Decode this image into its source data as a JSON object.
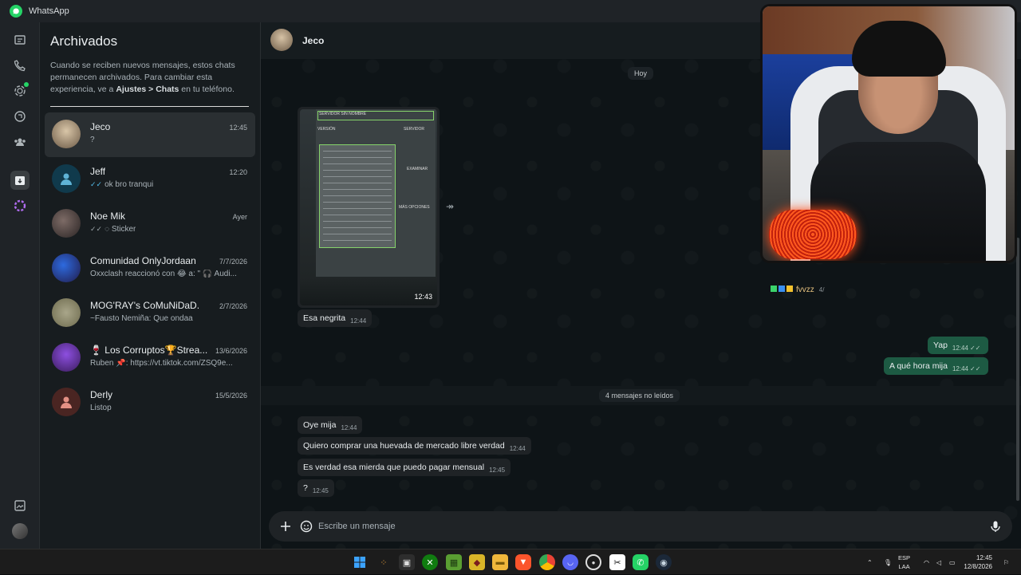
{
  "window": {
    "title": "WhatsApp"
  },
  "archived": {
    "title": "Archivados",
    "info_pre": "Cuando se reciben nuevos mensajes, estos chats permanecen archivados. Para cambiar esta experiencia, ve a ",
    "info_bold": "Ajustes > Chats",
    "info_post": " en tu teléfono."
  },
  "chats": [
    {
      "name": "Jeco",
      "time": "12:45",
      "preview": "?",
      "ticks": ""
    },
    {
      "name": "Jeff",
      "time": "12:20",
      "preview": "ok bro tranqui",
      "ticks": "✓✓"
    },
    {
      "name": "Noe Mik",
      "time": "Ayer",
      "preview": "Sticker",
      "ticks": "✓✓"
    },
    {
      "name": "Comunidad OnlyJordaan",
      "time": "7/7/2026",
      "preview": "Oxxclash reaccionó con 😂 a: \" 🎧 Audi...",
      "ticks": ""
    },
    {
      "name": "MOG'RAY's CoMuNiDaD.",
      "time": "2/7/2026",
      "preview": "~Fausto Nemiña: Que ondaa",
      "ticks": ""
    },
    {
      "name": "🍷 Los Corruptos🏆Strea...",
      "time": "13/6/2026",
      "preview": "Ruben 📌: https://vt.tiktok.com/ZSQ9e...",
      "ticks": ""
    },
    {
      "name": "Derly",
      "time": "15/5/2026",
      "preview": "Listop",
      "ticks": ""
    }
  ],
  "conversation": {
    "contact": "Jeco",
    "day_label": "Hoy",
    "image_time": "12:43",
    "unread_label": "4 mensajes no leídos",
    "messages": [
      {
        "text": "Esa negrita",
        "time": "12:44"
      },
      {
        "text": "Yap",
        "time": "12:44"
      },
      {
        "text": "A qué hora mija",
        "time": "12:44"
      },
      {
        "text": "Oye mija",
        "time": "12:44"
      },
      {
        "text": "Quiero comprar una huevada de mercado libre verdad",
        "time": "12:44"
      },
      {
        "text": "Es verdad esa mierda que puedo pagar mensual",
        "time": "12:45"
      },
      {
        "text": "?",
        "time": "12:45"
      }
    ],
    "composer_placeholder": "Escribe un mensaje"
  },
  "overlay": {
    "name": "fvvzz",
    "tag": "4/"
  },
  "image_texts": {
    "top": "SERVIDOR SIN NOMBRE",
    "version": "VERSIÓN",
    "server": "SERVIDOR",
    "examinar": "EXAMINAR",
    "opciones": "MÁS OPCIONES"
  },
  "taskbar": {
    "lang_line1": "ESP",
    "lang_line2": "LAA",
    "time": "12:45",
    "date": "12/8/2026"
  }
}
